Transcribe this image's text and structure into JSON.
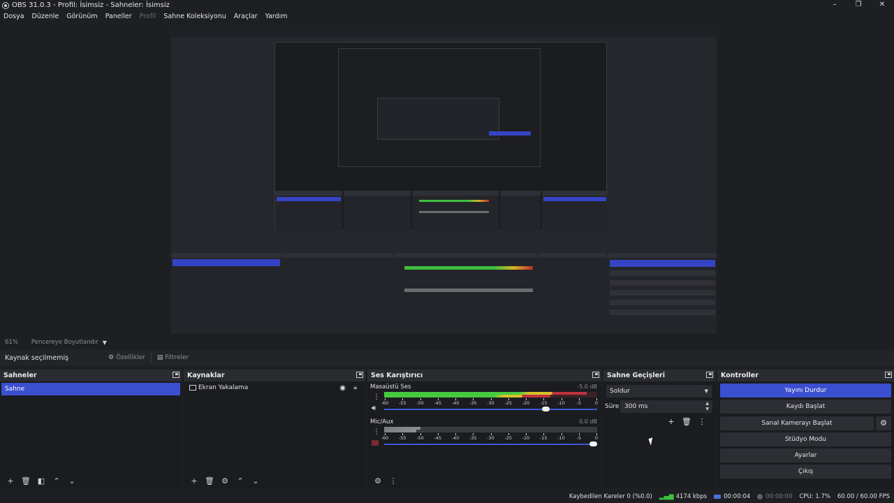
{
  "window": {
    "title": "OBS 31.0.3 - Profil: İsimsiz - Sahneler: İsimsiz",
    "controls": [
      "–",
      "❐",
      "✕"
    ]
  },
  "menu": [
    {
      "label": "Dosya",
      "enabled": true
    },
    {
      "label": "Düzenle",
      "enabled": true
    },
    {
      "label": "Görünüm",
      "enabled": true
    },
    {
      "label": "Paneller",
      "enabled": true
    },
    {
      "label": "Profil",
      "enabled": false
    },
    {
      "label": "Sahne Koleksiyonu",
      "enabled": true
    },
    {
      "label": "Araçlar",
      "enabled": true
    },
    {
      "label": "Yardım",
      "enabled": true
    }
  ],
  "preview": {
    "zoom": "61%",
    "scale_mode": "Pencereye Boyutlandır"
  },
  "source_toolbar": {
    "no_source": "Kaynak seçilmemiş",
    "properties": "Özellikler",
    "filters": "Filtreler"
  },
  "scenes": {
    "title": "Sahneler",
    "items": [
      "Sahne"
    ],
    "selected": "Sahne"
  },
  "sources": {
    "title": "Kaynaklar",
    "items": [
      {
        "name": "Ekran Yakalama",
        "visible": true,
        "locked": false
      }
    ]
  },
  "mixer": {
    "title": "Ses Karıştırıcı",
    "channels": [
      {
        "name": "Masaüstü Ses",
        "db": "-5.0 dB",
        "volume": 0.77,
        "level1": 0.95,
        "level2": 0.78,
        "muted": false
      },
      {
        "name": "Mic/Aux",
        "db": "0.0 dB",
        "volume": 1.0,
        "level1": 0.17,
        "level2": 0.15,
        "muted": true
      }
    ],
    "ticks": [
      "-60",
      "-55",
      "-50",
      "-45",
      "-40",
      "-35",
      "-30",
      "-25",
      "-20",
      "-15",
      "-10",
      "-5",
      "0"
    ]
  },
  "transitions": {
    "title": "Sahne Geçişleri",
    "selected": "Soldur",
    "duration_label": "Süre",
    "duration": "300 ms"
  },
  "controls": {
    "title": "Kontroller",
    "stop_stream": "Yayını Durdur",
    "start_record": "Kaydı Başlat",
    "virtual_cam": "Sanal Kamerayı Başlat",
    "studio_mode": "Stüdyo Modu",
    "settings": "Ayarlar",
    "exit": "Çıkış"
  },
  "status": {
    "dropped_frames": "Kaybedilen Kareler 0 (%0.0)",
    "bitrate": "4174 kbps",
    "stream_time": "00:00:04",
    "record_time": "00:00:00",
    "cpu": "CPU: 1.7%",
    "fps": "60.00 / 60.00 FPS"
  }
}
